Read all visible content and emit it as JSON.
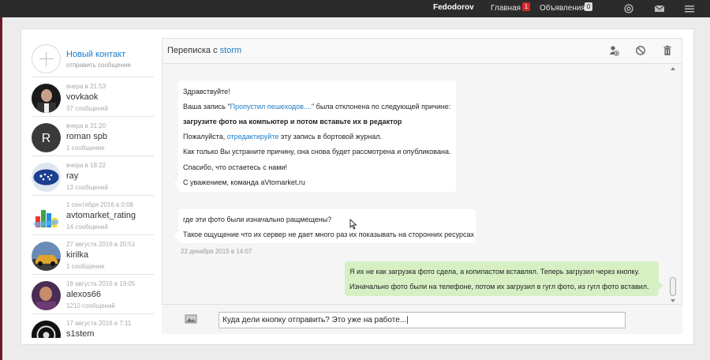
{
  "topbar": {
    "user": "Fedodorov",
    "nav": [
      {
        "label": "Главная",
        "badge": "1"
      },
      {
        "label": "Объявления",
        "badge": "0"
      }
    ],
    "icons": [
      "at-icon",
      "mail-icon",
      "menu-icon"
    ]
  },
  "sidebar": {
    "new_contact": {
      "title": "Новый контакт",
      "subtitle": "отправить сообщение"
    },
    "contacts": [
      {
        "time": "вчера в 21:53",
        "name": "vovkaok",
        "count": "37 сообщений",
        "avatar": "photo-dark"
      },
      {
        "time": "вчера в 21:20",
        "name": "roman spb",
        "count": "1 сообщение",
        "avatar": "initial",
        "initial": "R"
      },
      {
        "time": "вчера в 18:22",
        "name": "ray",
        "count": "13 сообщений",
        "avatar": "subaru-logo"
      },
      {
        "time": "1 сентября 2016 в 0:08",
        "name": "avtomarket_rating",
        "count": "14 сообщений",
        "avatar": "chart-logo"
      },
      {
        "time": "27 августа 2016 в 20:51",
        "name": "kirilka",
        "count": "1 сообщение",
        "avatar": "car-photo"
      },
      {
        "time": "18 августа 2016 в 19:05",
        "name": "alexos66",
        "count": "1210 сообщений",
        "avatar": "photo-purple"
      },
      {
        "time": "17 августа 2016 в 7:11",
        "name": "s1stem",
        "count": "",
        "avatar": "photo-dark2"
      }
    ]
  },
  "chat": {
    "title_prefix": "Переписка с ",
    "title_user": "storm",
    "header_icons": [
      "add-user-icon",
      "block-icon",
      "trash-icon"
    ],
    "message1": {
      "greeting": "Здравствуйте!",
      "line2_before": "Ваша запись \"",
      "line2_link": "Пропустил пешеходов....",
      "line2_after": "\" была отклонена по следующей причине:",
      "reason": "загрузите фото на компьютер и потом вставьте их в редактор",
      "line4_before": "Пожалуйста, ",
      "line4_link": "отредактируйте",
      "line4_after": " эту запись в бортовой журнал.",
      "line5": "Как только Вы устраните причину, она снова будет рассмотрена и опубликована.",
      "line6": "Спасибо, что остаетесь с нами!",
      "line7": "С уважением, команда aVtomarket.ru"
    },
    "message2": {
      "line1": "где эти фото были изначально ращмещены?",
      "line2": "Такое ощущение что их сервер не дает много раз их показывать на сторонних ресурсах",
      "date": "22 декабря 2015 в 14:07"
    },
    "message3": {
      "line1": "Я их не как загрузка фото сдела, а копипастом вставлял. Теперь загрузил через кнопку.",
      "line2": "Изначально фото были на телефоне, потом их загрузил в гугл фото, из гугл фото вставил."
    },
    "input_value": "Куда дели кнопку отправить? Это уже на работе...|"
  },
  "colors": {
    "link": "#1a7bc7",
    "own_bubble": "#d6f0c4",
    "topbar": "#2b2b2b",
    "badge": "#d7262a"
  }
}
